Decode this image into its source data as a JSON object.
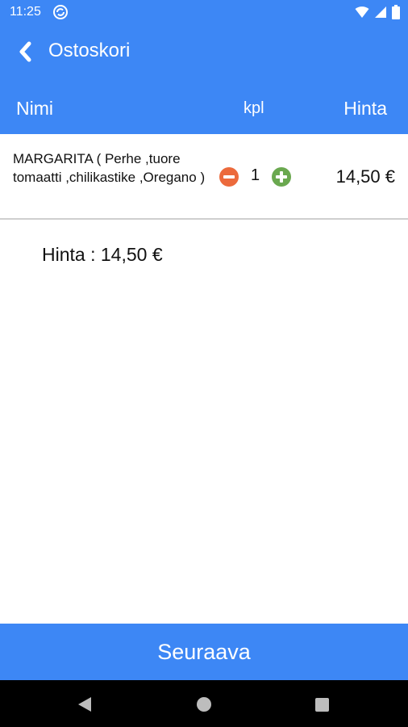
{
  "status_bar": {
    "time": "11:25",
    "icons": [
      "sync-icon",
      "wifi-icon",
      "signal-icon",
      "battery-icon"
    ]
  },
  "app_bar": {
    "back_icon": "chevron-left-icon",
    "title": "Ostoskori"
  },
  "table_header": {
    "name": "Nimi",
    "qty": "kpl",
    "price": "Hinta"
  },
  "cart": {
    "items": [
      {
        "name": "MARGARITA ( Perhe ,tuore tomaatti ,chilikastike ,Oregano )",
        "quantity": "1",
        "price": "14,50 €",
        "decrease_icon": "minus-circle-icon",
        "increase_icon": "plus-circle-icon"
      }
    ]
  },
  "total": {
    "label": "Hinta",
    "value": "14,50 €"
  },
  "next_button": {
    "label": "Seuraava"
  },
  "nav_bar": {
    "icons": [
      "back-triangle-icon",
      "home-circle-icon",
      "recents-square-icon"
    ]
  },
  "colors": {
    "primary": "#3d87f5",
    "minus": "#ec6a3c",
    "plus": "#6aa84f",
    "navbar": "#000000"
  }
}
